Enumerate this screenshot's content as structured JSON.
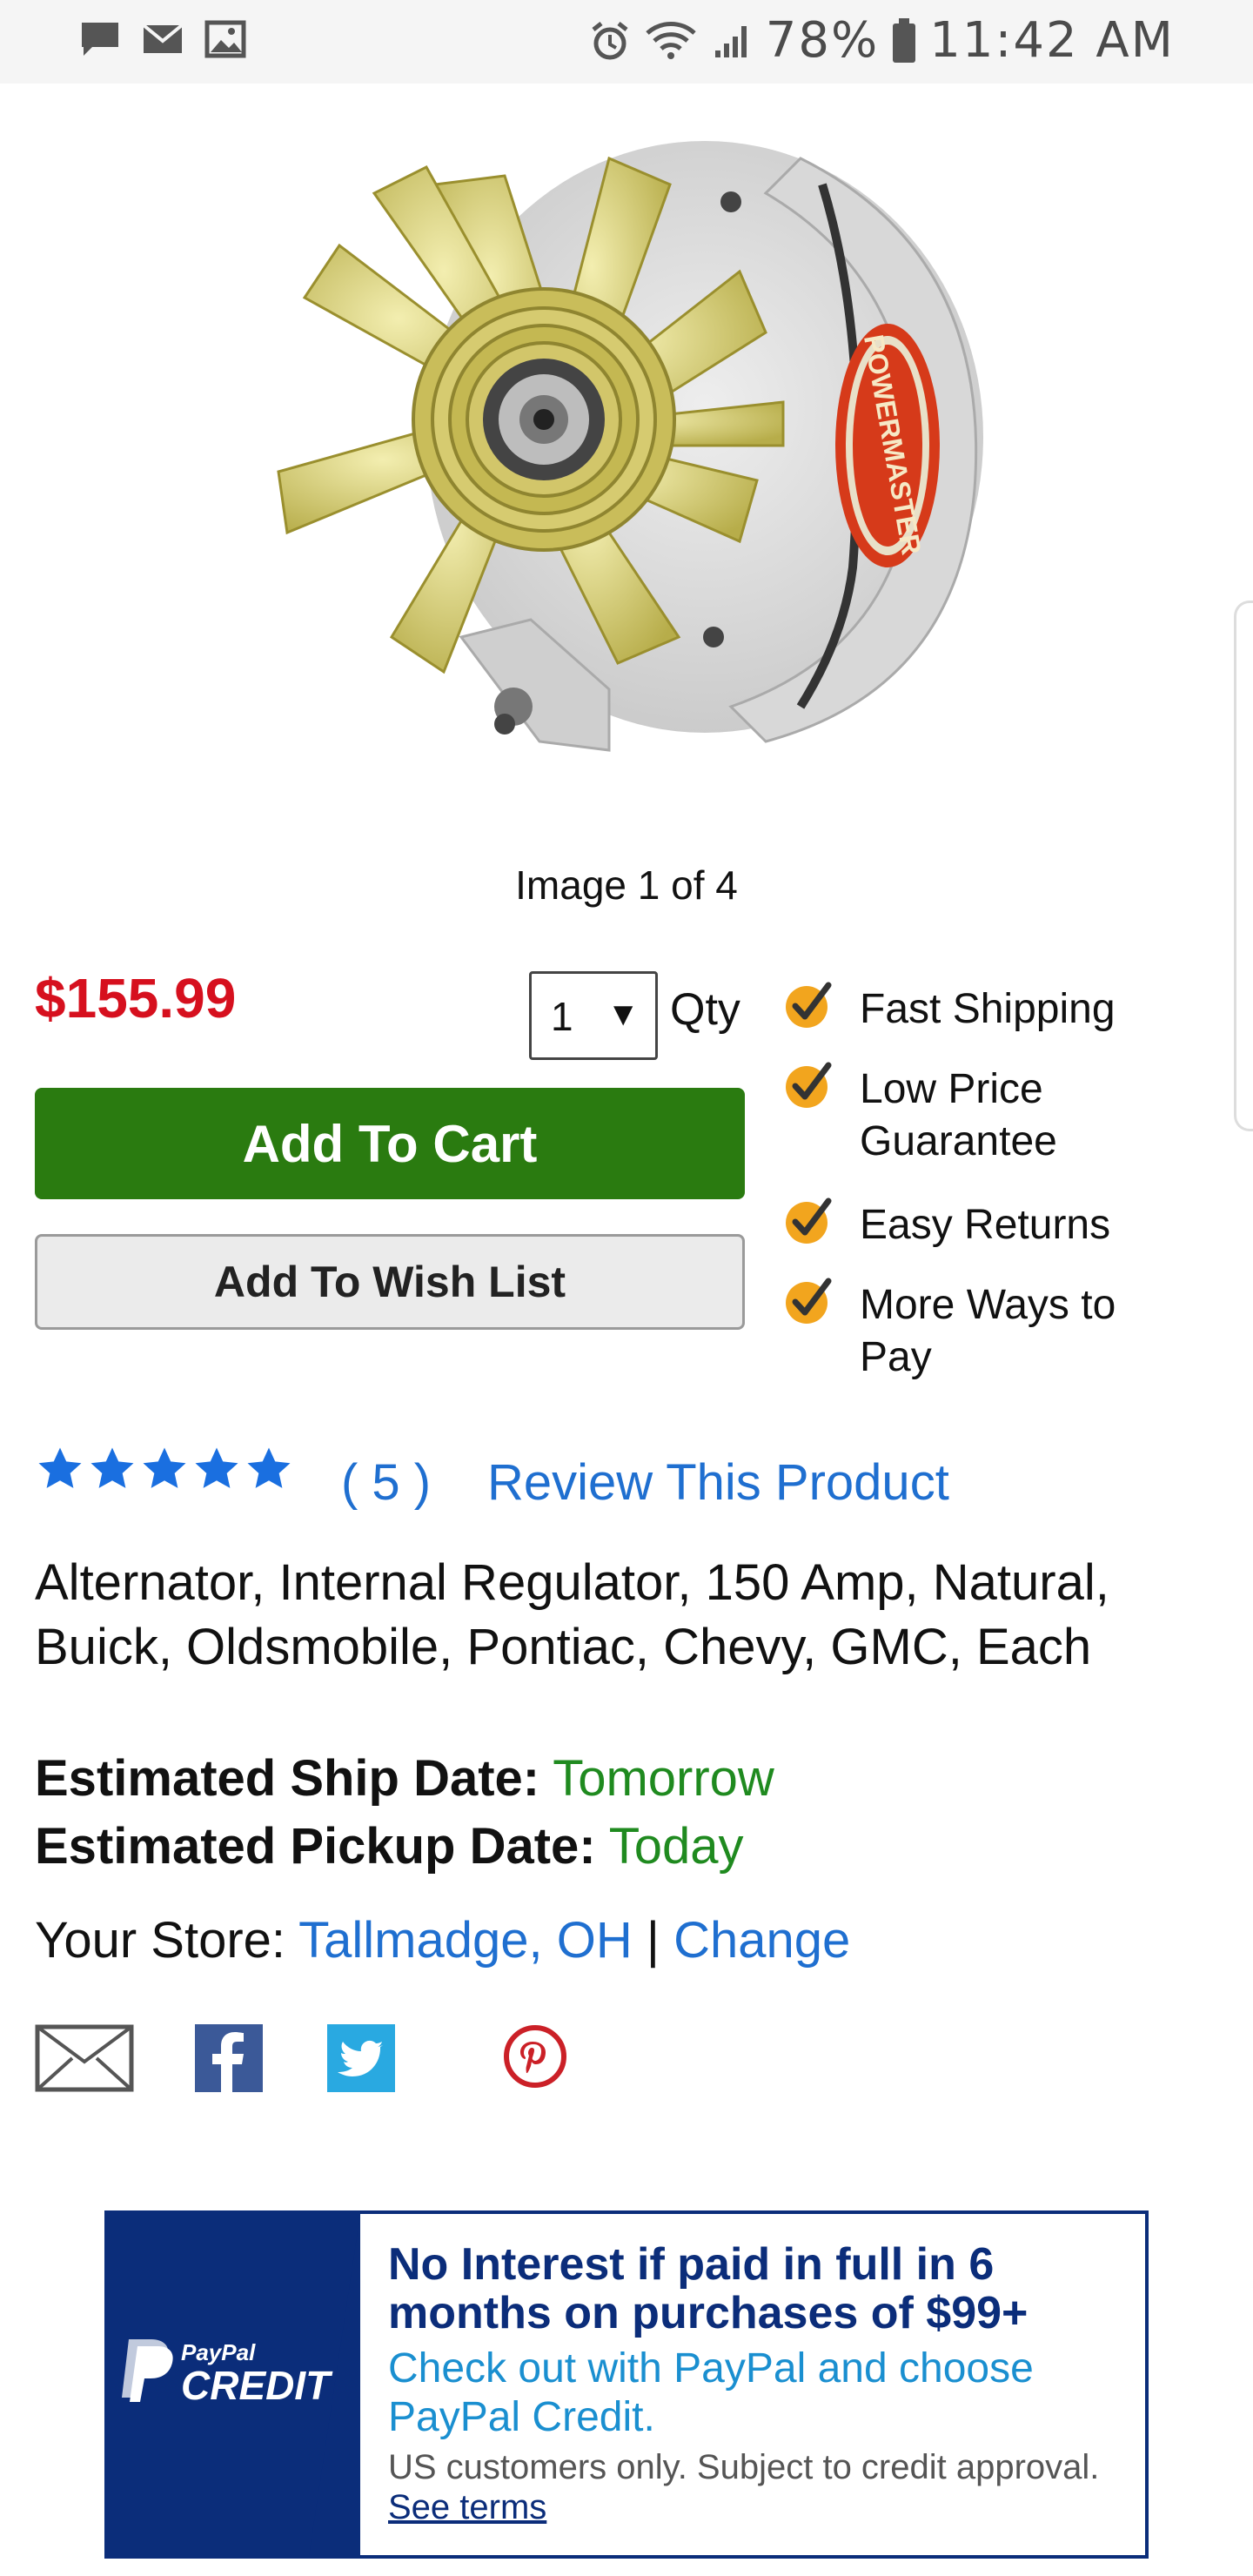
{
  "status_bar": {
    "battery": "78%",
    "time": "11:42 AM"
  },
  "product": {
    "image_counter": "Image 1 of 4",
    "price": "$155.99",
    "qty_value": "1",
    "qty_label": "Qty",
    "add_to_cart": "Add To Cart",
    "add_to_wish_list": "Add To Wish List",
    "description": "Alternator, Internal Regulator, 150 Amp, Natural, Buick, Oldsmobile, Pontiac, Chevy, GMC, Each",
    "brand_label": "POWERMASTER"
  },
  "benefits": [
    {
      "label": "Fast Shipping",
      "icon": "check-icon"
    },
    {
      "label": "Low Price Guarantee",
      "icon": "check-icon"
    },
    {
      "label": "Easy Returns",
      "icon": "check-icon"
    },
    {
      "label": "More Ways to Pay",
      "icon": "check-icon"
    }
  ],
  "rating": {
    "stars": 5,
    "count_text": "( 5 )",
    "review_link": "Review This Product"
  },
  "shipping": {
    "ship_key": "Estimated Ship Date:",
    "ship_value": "Tomorrow",
    "pickup_key": "Estimated Pickup Date:",
    "pickup_value": "Today",
    "store_key": "Your Store:",
    "store_value": "Tallmadge, OH",
    "separator": "|",
    "change_link": "Change"
  },
  "share_icons": [
    "email-icon",
    "facebook-icon",
    "twitter-icon",
    "pinterest-icon"
  ],
  "paypal": {
    "logo_small": "PayPal",
    "logo_big": "CREDIT",
    "headline": "No Interest if paid in full in 6 months on purchases of $99+",
    "sub": "Check out with PayPal and choose PayPal Credit.",
    "fine": "US customers only. Subject to credit approval.",
    "terms_link": "See terms"
  },
  "colors": {
    "price_red": "#d6101e",
    "cart_green": "#2a7b10",
    "link_blue": "#1f6fd0",
    "date_green": "#1f8a1f",
    "paypal_navy": "#0b2d7a",
    "check_orange": "#f2a51e"
  }
}
